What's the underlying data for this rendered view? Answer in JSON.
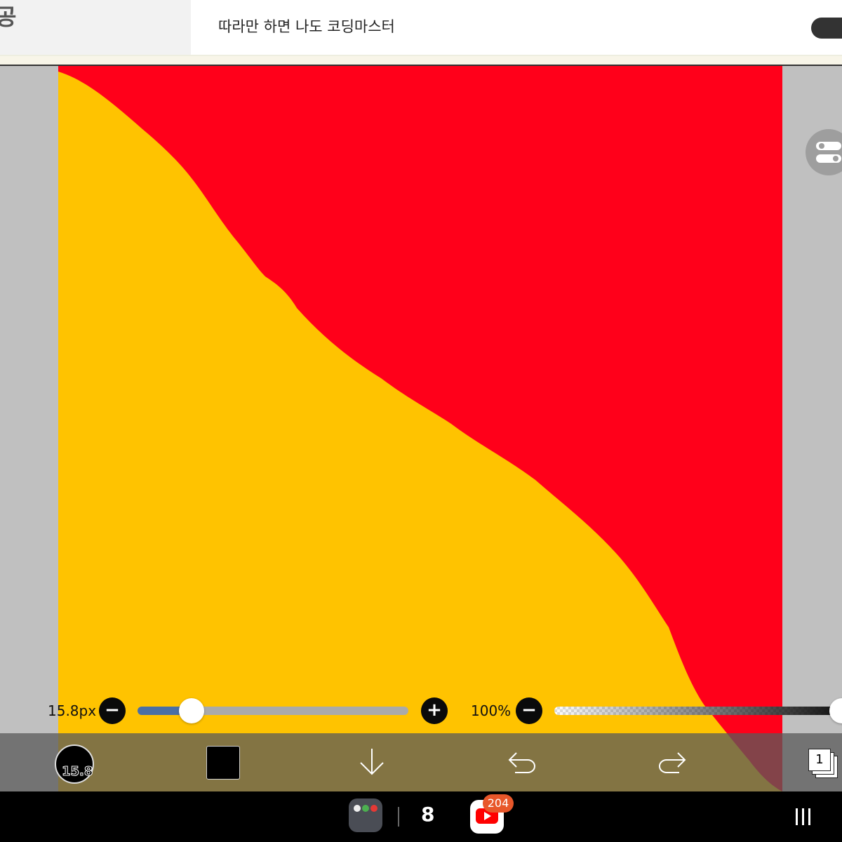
{
  "top_bar": {
    "partial_title": "공",
    "tab_title": "따라만 하면 나도 코딩마스터"
  },
  "canvas": {
    "colors": {
      "background": "#ff001a",
      "fill": "#ffc300"
    }
  },
  "brush_size": {
    "value_label": "15.8px",
    "decrease_symbol": "−",
    "increase_symbol": "+",
    "level": 0.2,
    "accent": "#4a6fa5"
  },
  "opacity": {
    "value_label": "100%",
    "decrease_symbol": "−",
    "level": 1.0
  },
  "toolbar": {
    "brush_preview_label": "15.8",
    "current_color": "#000000",
    "icons": [
      "brush-preview-icon",
      "color-swatch",
      "download-icon",
      "undo-icon",
      "redo-icon",
      "layers-icon"
    ],
    "layer_count": "1"
  },
  "navbar": {
    "apps": [
      "app-folder-icon",
      "s-app-icon",
      "youtube-icon"
    ],
    "youtube_badge": "204"
  }
}
